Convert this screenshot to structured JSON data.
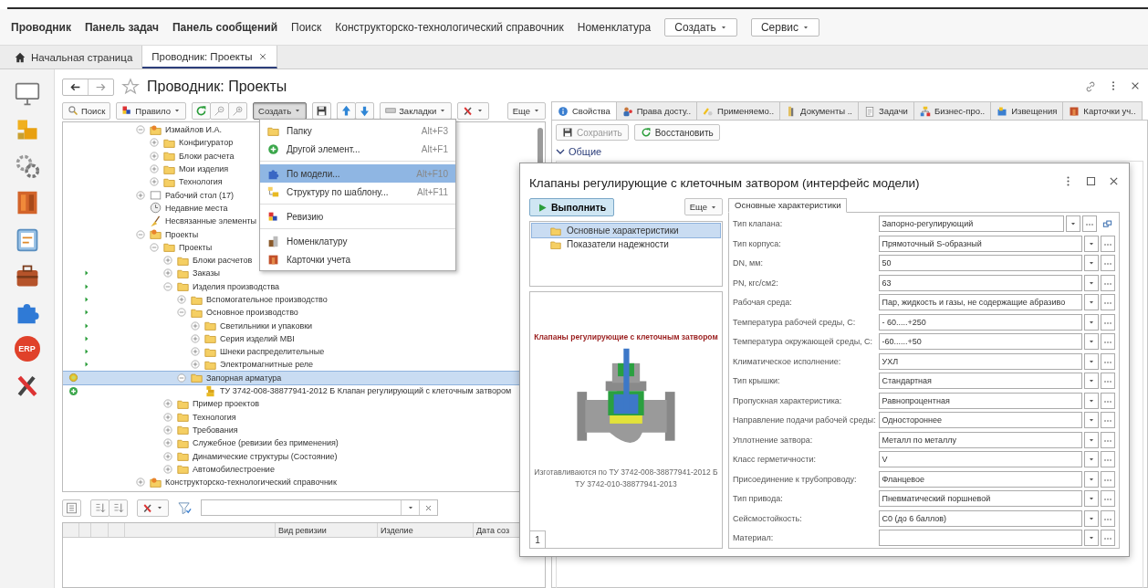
{
  "menu_bar": {
    "items": [
      {
        "label": "Проводник",
        "bold": true
      },
      {
        "label": "Панель задач",
        "bold": true
      },
      {
        "label": "Панель сообщений",
        "bold": true
      },
      {
        "label": "Поиск",
        "bold": false
      },
      {
        "label": "Конструкторско-технологический справочник",
        "bold": false
      },
      {
        "label": "Номенклатура",
        "bold": false
      }
    ],
    "buttons": [
      {
        "label": "Создать"
      },
      {
        "label": "Сервис"
      }
    ]
  },
  "tabs": [
    {
      "label": "Начальная страница",
      "kind": "home",
      "closable": false,
      "selected": false
    },
    {
      "label": "Проводник: Проекты",
      "kind": "page",
      "closable": true,
      "selected": true
    }
  ],
  "sidebar": {
    "badge": "ERP"
  },
  "page": {
    "title": "Проводник: Проекты"
  },
  "toolbar": [
    {
      "label": "Поиск",
      "dropdown": false,
      "pressed": false
    },
    {
      "label": "Правило",
      "dropdown": true,
      "pressed": false
    },
    {
      "label": "Создать",
      "dropdown": true,
      "pressed": true
    },
    {
      "label": "Закладки",
      "dropdown": true,
      "pressed": false
    },
    {
      "label": "Еще",
      "dropdown": true,
      "pressed": false
    }
  ],
  "tree": [
    {
      "label": "Измайлов И.А.",
      "kind": "person",
      "expanded": true,
      "selected": false,
      "children": [
        {
          "label": "Конфигуратор",
          "kind": "folder",
          "expanded": false,
          "selected": false
        },
        {
          "label": "Блоки расчета",
          "kind": "folder",
          "expanded": false,
          "selected": false
        },
        {
          "label": "Мои изделия",
          "kind": "folder",
          "expanded": false,
          "selected": false
        },
        {
          "label": "Технология",
          "kind": "folder",
          "expanded": false,
          "selected": false
        }
      ]
    },
    {
      "label": "Рабочий стол (17)",
      "kind": "desktop",
      "expanded": false,
      "selected": false
    },
    {
      "label": "Недавние места",
      "kind": "recent",
      "selected": false
    },
    {
      "label": "Несвязанные элементы",
      "kind": "unlinked",
      "selected": false
    },
    {
      "label": "Проекты",
      "kind": "person",
      "expanded": true,
      "selected": false,
      "children": [
        {
          "label": "Проекты",
          "kind": "folder",
          "expanded": true,
          "selected": false,
          "children": [
            {
              "label": "Блоки расчетов",
              "kind": "folder",
              "expanded": false,
              "selected": false
            },
            {
              "label": "Заказы",
              "kind": "folder",
              "expanded": false,
              "selected": false,
              "tagged": true
            },
            {
              "label": "Изделия производства",
              "kind": "folder",
              "expanded": true,
              "selected": false,
              "tagged": true,
              "children": [
                {
                  "label": "Вспомогательное производство",
                  "kind": "folder",
                  "expanded": false,
                  "selected": false,
                  "tagged": true
                },
                {
                  "label": "Основное производство",
                  "kind": "folder",
                  "expanded": true,
                  "selected": false,
                  "tagged": true,
                  "children": [
                    {
                      "label": "Светильники и упаковки",
                      "kind": "folder",
                      "expanded": false,
                      "selected": false,
                      "tagged": true
                    },
                    {
                      "label": "Серия изделий MBI",
                      "kind": "folder",
                      "expanded": false,
                      "selected": false,
                      "tagged": true
                    },
                    {
                      "label": "Шнеки распределительные",
                      "kind": "folder",
                      "expanded": false,
                      "selected": false,
                      "tagged": true
                    },
                    {
                      "label": "Электромагнитные реле",
                      "kind": "folder",
                      "expanded": false,
                      "selected": false,
                      "tagged": true
                    }
                  ]
                },
                {
                  "label": "Запорная арматура",
                  "kind": "folder",
                  "expanded": true,
                  "selected": true,
                  "current": true,
                  "children": [
                    {
                      "label": "ТУ 3742-008-38877941-2012 Б Клапан регулирующий с клеточным затвором",
                      "kind": "product",
                      "selected": false,
                      "added": true
                    }
                  ]
                }
              ]
            },
            {
              "label": "Пример проектов",
              "kind": "folder",
              "expanded": false,
              "selected": false
            },
            {
              "label": "Технология",
              "kind": "folder",
              "expanded": false,
              "selected": false
            },
            {
              "label": "Требования",
              "kind": "folder",
              "expanded": false,
              "selected": false
            },
            {
              "label": "Служебное (ревизии без применения)",
              "kind": "folder",
              "expanded": false,
              "selected": false
            },
            {
              "label": "Динамические структуры (Состояние)",
              "kind": "folder",
              "expanded": false,
              "selected": false
            },
            {
              "label": "Автомобилестроение",
              "kind": "folder",
              "expanded": false,
              "selected": false
            }
          ]
        }
      ]
    },
    {
      "label": "Конструкторско-технологический справочник",
      "kind": "person",
      "expanded": false,
      "selected": false
    }
  ],
  "revisions": {
    "columns": [
      "Вид ревизии",
      "Изделие",
      "Дата соз"
    ]
  },
  "right_panel": {
    "tabs": [
      {
        "label": "Свойства",
        "selected": true
      },
      {
        "label": "Права досту..",
        "selected": false
      },
      {
        "label": "Применяемо..",
        "selected": false
      },
      {
        "label": "Документы ..",
        "selected": false
      },
      {
        "label": "Задачи",
        "selected": false
      },
      {
        "label": "Бизнес-про..",
        "selected": false
      },
      {
        "label": "Извещения",
        "selected": false
      },
      {
        "label": "Карточки уч..",
        "selected": false
      }
    ],
    "buttons": [
      {
        "label": "Сохранить",
        "disabled": true
      },
      {
        "label": "Восстановить",
        "disabled": false
      }
    ],
    "group": {
      "label": "Общие",
      "expanded": true
    }
  },
  "create_menu": {
    "groups": [
      [
        {
          "label": "Папку",
          "shortcut": "Alt+F3",
          "selected": false
        },
        {
          "label": "Другой элемент...",
          "shortcut": "Alt+F1",
          "selected": false
        }
      ],
      [
        {
          "label": "По модели...",
          "shortcut": "Alt+F10",
          "selected": true
        },
        {
          "label": "Структуру по шаблону...",
          "shortcut": "Alt+F11",
          "selected": false
        }
      ],
      [
        {
          "label": "Ревизию",
          "selected": false
        }
      ],
      [
        {
          "label": "Номенклатуру",
          "selected": false
        },
        {
          "label": "Карточки учета",
          "selected": false
        }
      ]
    ]
  },
  "dialog": {
    "title": "Клапаны регулирующие с клеточным затвором (интерфейс модели)",
    "run_button": "Выполнить",
    "more_button": "Еще",
    "sections": [
      {
        "label": "Основные характеристики",
        "selected": true
      },
      {
        "label": "Показатели надежности",
        "selected": false
      }
    ],
    "image": {
      "title": "Клапаны регулирующие с клеточным затвором",
      "caption": [
        "Изготавливаются по ТУ 3742-008-38877941-2012 Б",
        "ТУ 3742-010-38877941-2013"
      ]
    },
    "page_tab": "1",
    "form_tab": {
      "label": "Основные характеристики",
      "selected": true
    },
    "fields": [
      {
        "label": "Тип клапана:",
        "value": "Запорно-регулирующий",
        "link": true
      },
      {
        "label": "Тип корпуса:",
        "value": "Прямоточный S-образный"
      },
      {
        "label": "DN, мм:",
        "value": "50"
      },
      {
        "label": "PN, кгс/см2:",
        "value": "63"
      },
      {
        "label": "Рабочая среда:",
        "value": "Пар, жидкость и газы, не содержащие абразиво"
      },
      {
        "label": "Температура рабочей среды, С:",
        "value": "- 60.....+250"
      },
      {
        "label": "Температура окружающей среды, С:",
        "value": "-60......+50"
      },
      {
        "label": "Климатическое исполнение:",
        "value": "УХЛ"
      },
      {
        "label": "Тип крышки:",
        "value": "Стандартная"
      },
      {
        "label": "Пропускная характеристика:",
        "value": "Равнопроцентная"
      },
      {
        "label": "Направление подачи рабочей среды:",
        "value": "Одностороннее"
      },
      {
        "label": "Уплотнение затвора:",
        "value": "Металл по металлу"
      },
      {
        "label": "Класс герметичности:",
        "value": "V"
      },
      {
        "label": "Присоединение к трубопроводу:",
        "value": "Фланцевое"
      },
      {
        "label": "Тип привода:",
        "value": "Пневматический поршневой"
      },
      {
        "label": "Сейсмостойкость:",
        "value": "С0 (до 6 баллов)"
      },
      {
        "label": "Материал:"
      }
    ]
  }
}
